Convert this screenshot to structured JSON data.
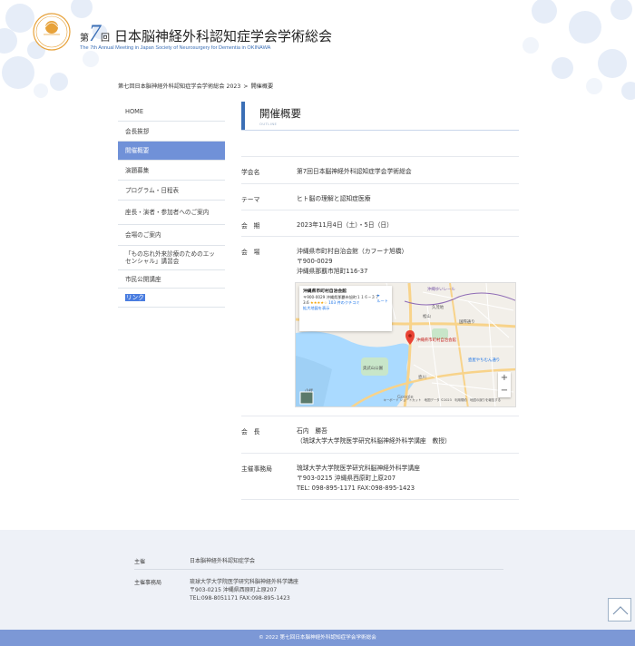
{
  "header": {
    "title_prefix": "第",
    "title_number": "7",
    "title_suffix": "回",
    "title_main": "日本脳神経外科認知症学会学術総会",
    "title_en": "The 7th Annual Meeting in Japan Society of Neurosurgery for Dementia in OKINAWA",
    "logo_text": "日本脳神経外科認知症学会"
  },
  "breadcrumb": {
    "home": "第七回日本脳神経外科認知症学会学術総会 2023",
    "separator": ">",
    "current": "開催概要"
  },
  "sidebar": {
    "items": [
      {
        "label": "HOME"
      },
      {
        "label": "会長挨拶"
      },
      {
        "label": "開催概要"
      },
      {
        "label": "演題募集"
      },
      {
        "label": "プログラム・日程表"
      },
      {
        "label": "座長・演者・参加者へのご案内"
      },
      {
        "label": "会場のご案内"
      },
      {
        "label": "「もの忘れ外来診療のためのエッセンシャル」講習会"
      },
      {
        "label": "市民公開講座"
      },
      {
        "label": "リンク"
      }
    ]
  },
  "main": {
    "heading": "開催概要",
    "heading_en": "OUTLINE",
    "rows": [
      {
        "label": "学会名",
        "lines": [
          "第7回日本脳神経外科認知症学会学術総会"
        ]
      },
      {
        "label": "テーマ",
        "lines": [
          "ヒト脳の理解と認知症医療"
        ]
      },
      {
        "label": "会　期",
        "lines": [
          "2023年11月4日（土）・5日（日）"
        ]
      },
      {
        "label": "会　場",
        "lines": [
          "沖縄県市町村自治会館（カフーナ旭橋）",
          "〒900-0029",
          "沖縄県那覇市旭町116-37"
        ]
      },
      {
        "label": "会　長",
        "lines": [
          "石内　勝吾",
          "（琉球大学大学院医学研究科脳神経外科学講座　教授）"
        ]
      },
      {
        "label": "主催事務局",
        "lines": [
          "琉球大学大学院医学研究科脳神経外科学講座",
          "〒903-0215 沖縄県西原町上原207",
          "TEL: 098-895-1171 FAX:098-895-1423"
        ]
      }
    ]
  },
  "map": {
    "place_name": "沖縄県市町村自治会館",
    "address": "〒900-0029 沖縄県那覇市旭町１１６−３７",
    "route_label": "ルート",
    "rating": "3.6",
    "stars": "★★★★☆",
    "reviews": "103 件のクチコミ",
    "enlarge": "拡大地図を表示",
    "pin_label": "沖縄県市町村自治会館",
    "zoom_in": "+",
    "zoom_out": "−",
    "google": "Google",
    "footer": "キーボード ショートカット　地図データ ©2023　利用規約　地図の誤りを報告する",
    "labels": [
      "那覇市",
      "奥武山公園",
      "壺屋やちむん通り",
      "沖縄ゆいレール",
      "国際通り",
      "壺川",
      "松山",
      "久茂地",
      "小禄"
    ],
    "colors": {
      "water": "#aadaff",
      "land": "#f2efe9",
      "road_major": "#f8d38a",
      "road": "#ffffff",
      "park": "#c8e6c9",
      "pin": "#ea4335"
    }
  },
  "footer": {
    "organizer_label": "主催",
    "organizer_value": "日本脳神経外科認知症学会",
    "office_label": "主催事務局",
    "office_lines": [
      "琉球大学大学院医学研究科脳神経外科学講座",
      "〒903-0215 沖縄県西原町上原207",
      "TEL:098-8051171 FAX:098-895-1423"
    ],
    "copyright": "© 2022 第七回日本脳神経外科認知症学会学術総会"
  },
  "colors": {
    "accent": "#3b6fb6",
    "sidebar_active": "#7091d8",
    "footer_bg": "#eef1f7",
    "copyright_bg": "#7c98d6"
  }
}
